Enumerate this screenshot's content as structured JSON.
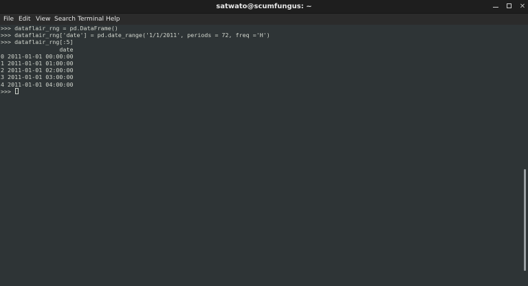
{
  "window": {
    "title": "satwato@scumfungus: ~"
  },
  "menu": [
    "File",
    "Edit",
    "View",
    "Search",
    "Terminal",
    "Help"
  ],
  "terminal": {
    "lines": [
      ">>> dataflair_rng = pd.DataFrame()",
      ">>> dataflair_rng['date'] = pd.date_range('1/1/2011', periods = 72, freq ='H')",
      ">>> dataflair_rng[:5]",
      "                 date",
      "0 2011-01-01 00:00:00",
      "1 2011-01-01 01:00:00",
      "2 2011-01-01 02:00:00",
      "3 2011-01-01 03:00:00",
      "4 2011-01-01 04:00:00"
    ],
    "prompt": ">>> "
  },
  "colors": {
    "titlebar": "#1e1e1e",
    "terminal_bg": "#2e3436",
    "terminal_fg": "#d3d7cf"
  }
}
